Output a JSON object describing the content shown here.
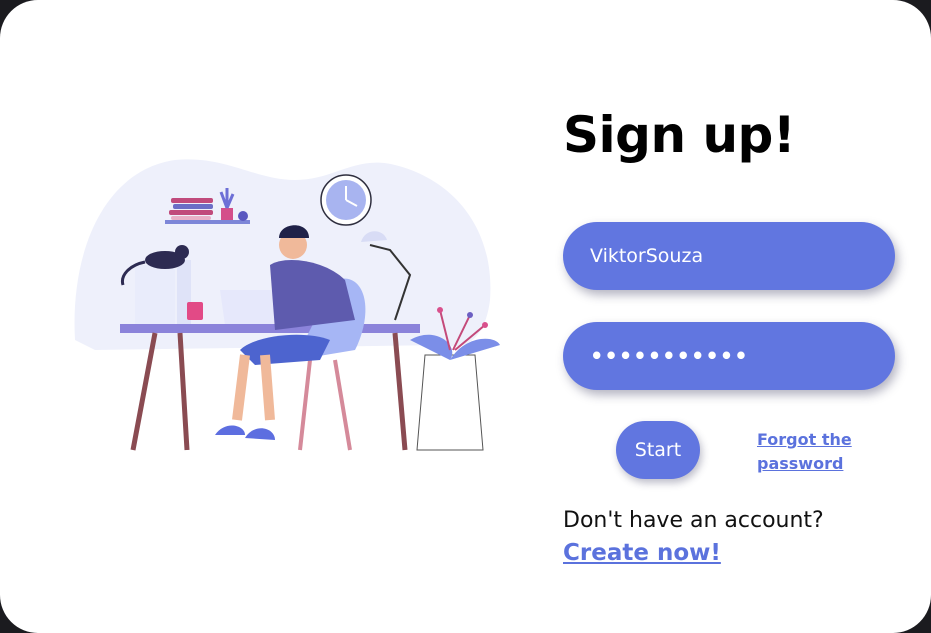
{
  "page": {
    "title": "Sign up!"
  },
  "form": {
    "username_value": "ViktorSouza",
    "password_value": "•••••••••••",
    "start_label": "Start",
    "forgot_label": "Forgot the password"
  },
  "footer": {
    "question": "Don't have an account?",
    "create_label": "Create now!"
  },
  "colors": {
    "accent": "#6176e0",
    "link": "#5b72dd",
    "background": "#ffffff"
  }
}
